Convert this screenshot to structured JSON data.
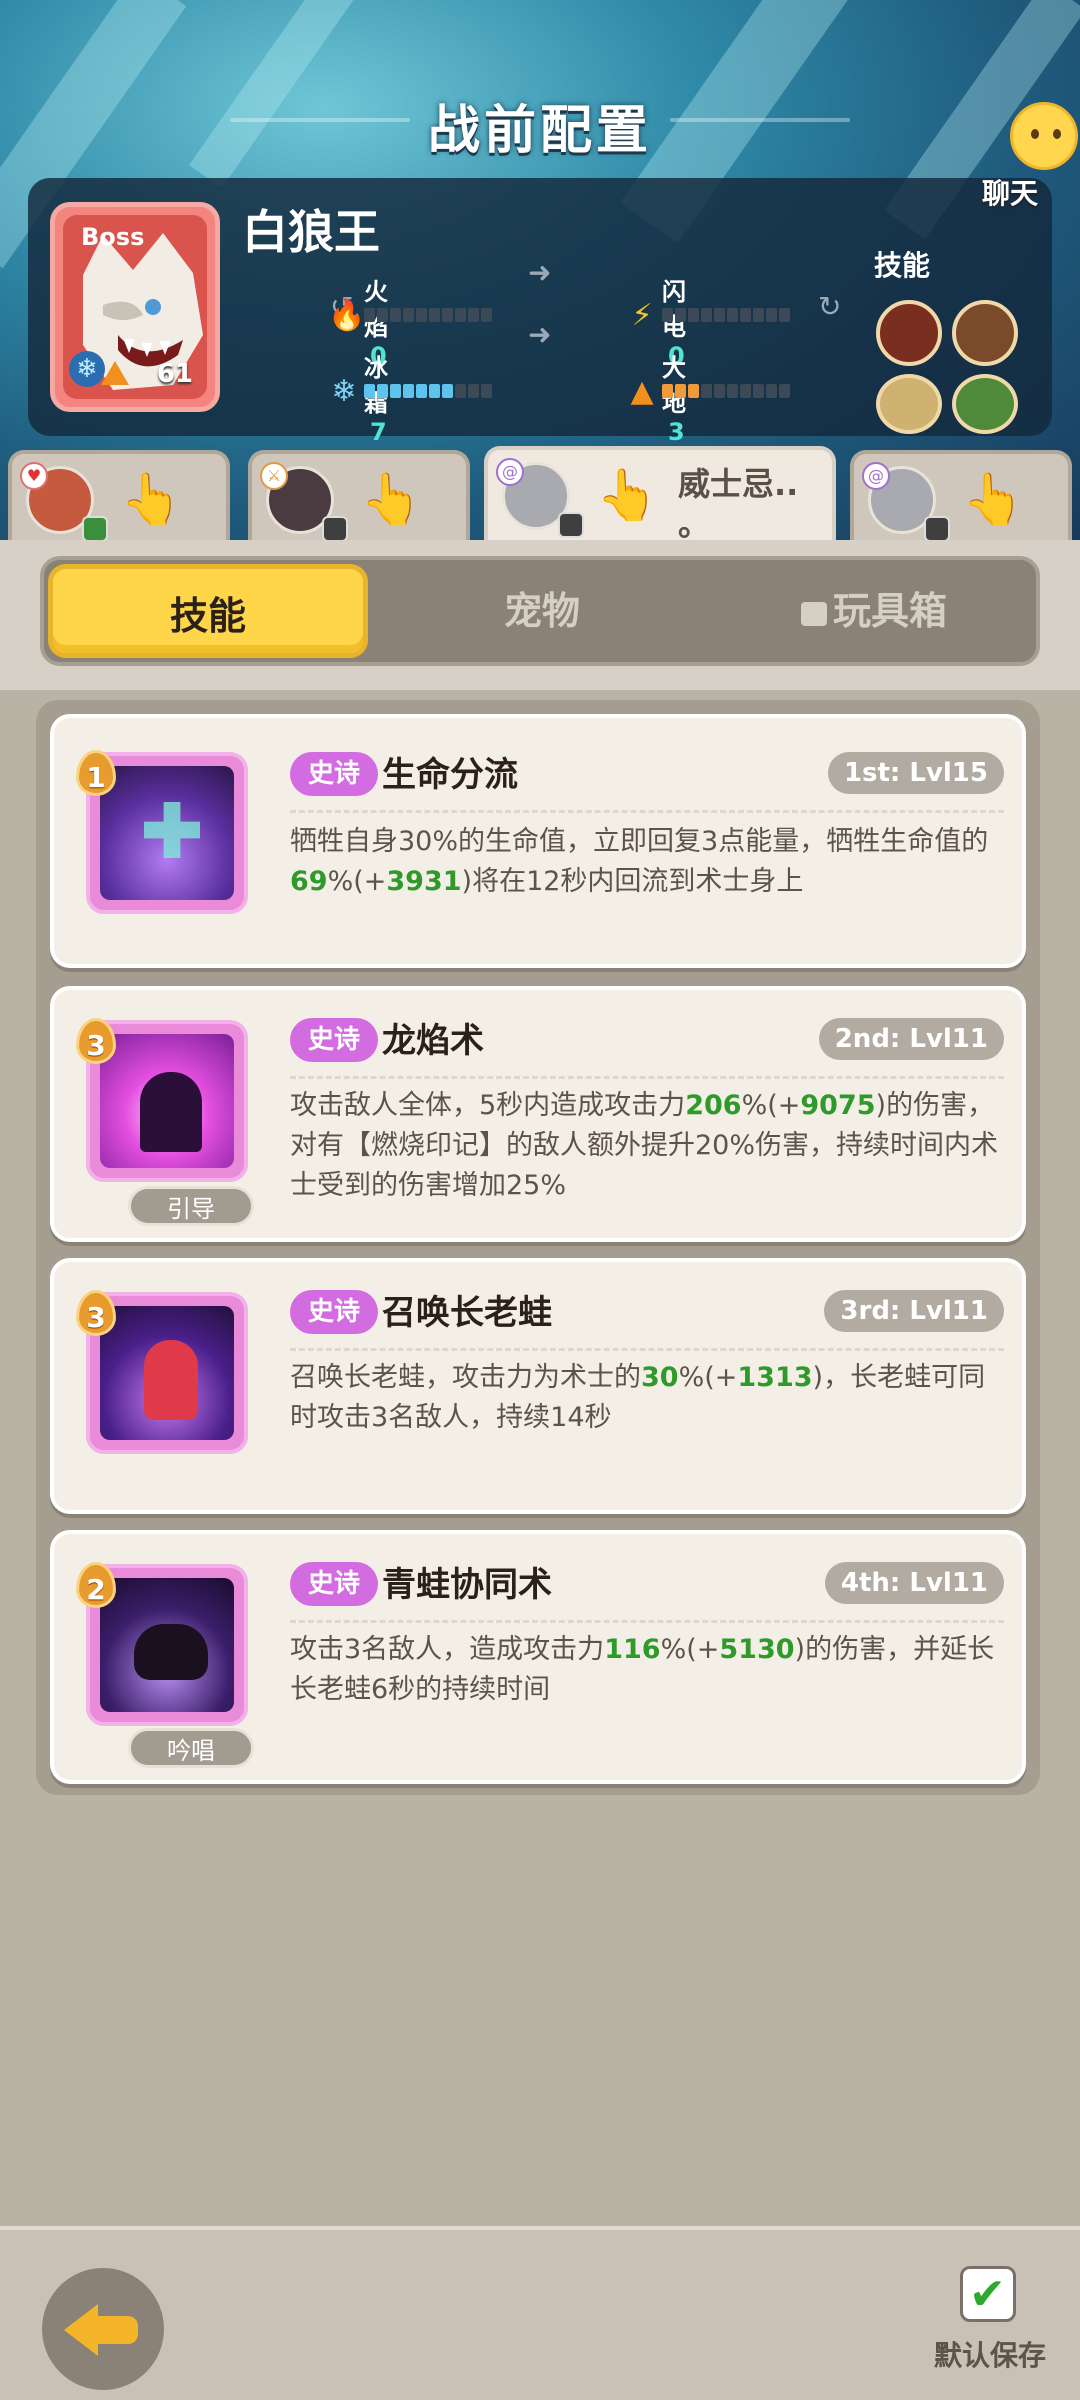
{
  "page": {
    "title": "战前配置"
  },
  "boss": {
    "tag": "Boss",
    "name": "白狼王",
    "level": "61",
    "elements": {
      "fire": {
        "label": "火焰",
        "value": "0",
        "filled": 0
      },
      "lightning": {
        "label": "闪电",
        "value": "0",
        "filled": 0
      },
      "frost": {
        "label": "冰霜",
        "value": "7",
        "filled": 7
      },
      "earth": {
        "label": "大地",
        "value": "3",
        "filled": 3
      }
    },
    "skills_label": "技能"
  },
  "chat": {
    "label": "聊天"
  },
  "heroes": [
    {
      "name": "",
      "badge_icon": "heart-icon"
    },
    {
      "name": "",
      "badge_icon": "sword-icon"
    },
    {
      "name": "威士忌..\n。",
      "badge_icon": "swirl-icon",
      "active": true
    },
    {
      "name": "",
      "badge_icon": "swirl-icon"
    }
  ],
  "categories": [
    {
      "label": "技能",
      "active": true
    },
    {
      "label": "宠物",
      "active": false
    },
    {
      "label": "玩具箱",
      "locked": true
    }
  ],
  "skills": [
    {
      "num": "1",
      "rarity": "史诗",
      "name": "生命分流",
      "slot": "1st: Lvl15",
      "desc_parts": [
        "牺牲自身30%的生命值，立即回复3点能量，牺牲生命值的",
        "69",
        "%(+",
        "3931",
        ")将在12秒内回流到术士身上"
      ],
      "tag": ""
    },
    {
      "num": "3",
      "rarity": "史诗",
      "name": "龙焰术",
      "slot": "2nd: Lvl11",
      "desc_parts": [
        "攻击敌人全体，5秒内造成攻击力",
        "206",
        "%(+",
        "9075",
        ")的伤害，对有【燃烧印记】的敌人额外提升20%伤害，持续时间内术士受到的伤害增加25%"
      ],
      "tag": "引导"
    },
    {
      "num": "3",
      "rarity": "史诗",
      "name": "召唤长老蛙",
      "slot": "3rd: Lvl11",
      "desc_parts": [
        "召唤长老蛙，攻击力为术士的",
        "30",
        "%(+",
        "1313",
        ")，长老蛙可同时攻击3名敌人，持续14秒"
      ],
      "tag": ""
    },
    {
      "num": "2",
      "rarity": "史诗",
      "name": "青蛙协同术",
      "slot": "4th: Lvl11",
      "desc_parts": [
        "攻击3名敌人，造成攻击力",
        "116",
        "%(+",
        "5130",
        ")的伤害，并延长长老蛙6秒的持续时间"
      ],
      "tag": "吟唱"
    }
  ],
  "footer": {
    "save_label": "默认保存",
    "save_checked": true
  },
  "colors": {
    "accent": "#ffd54a",
    "epic": "#d36ce0",
    "bonus": "#2f9a2a"
  }
}
